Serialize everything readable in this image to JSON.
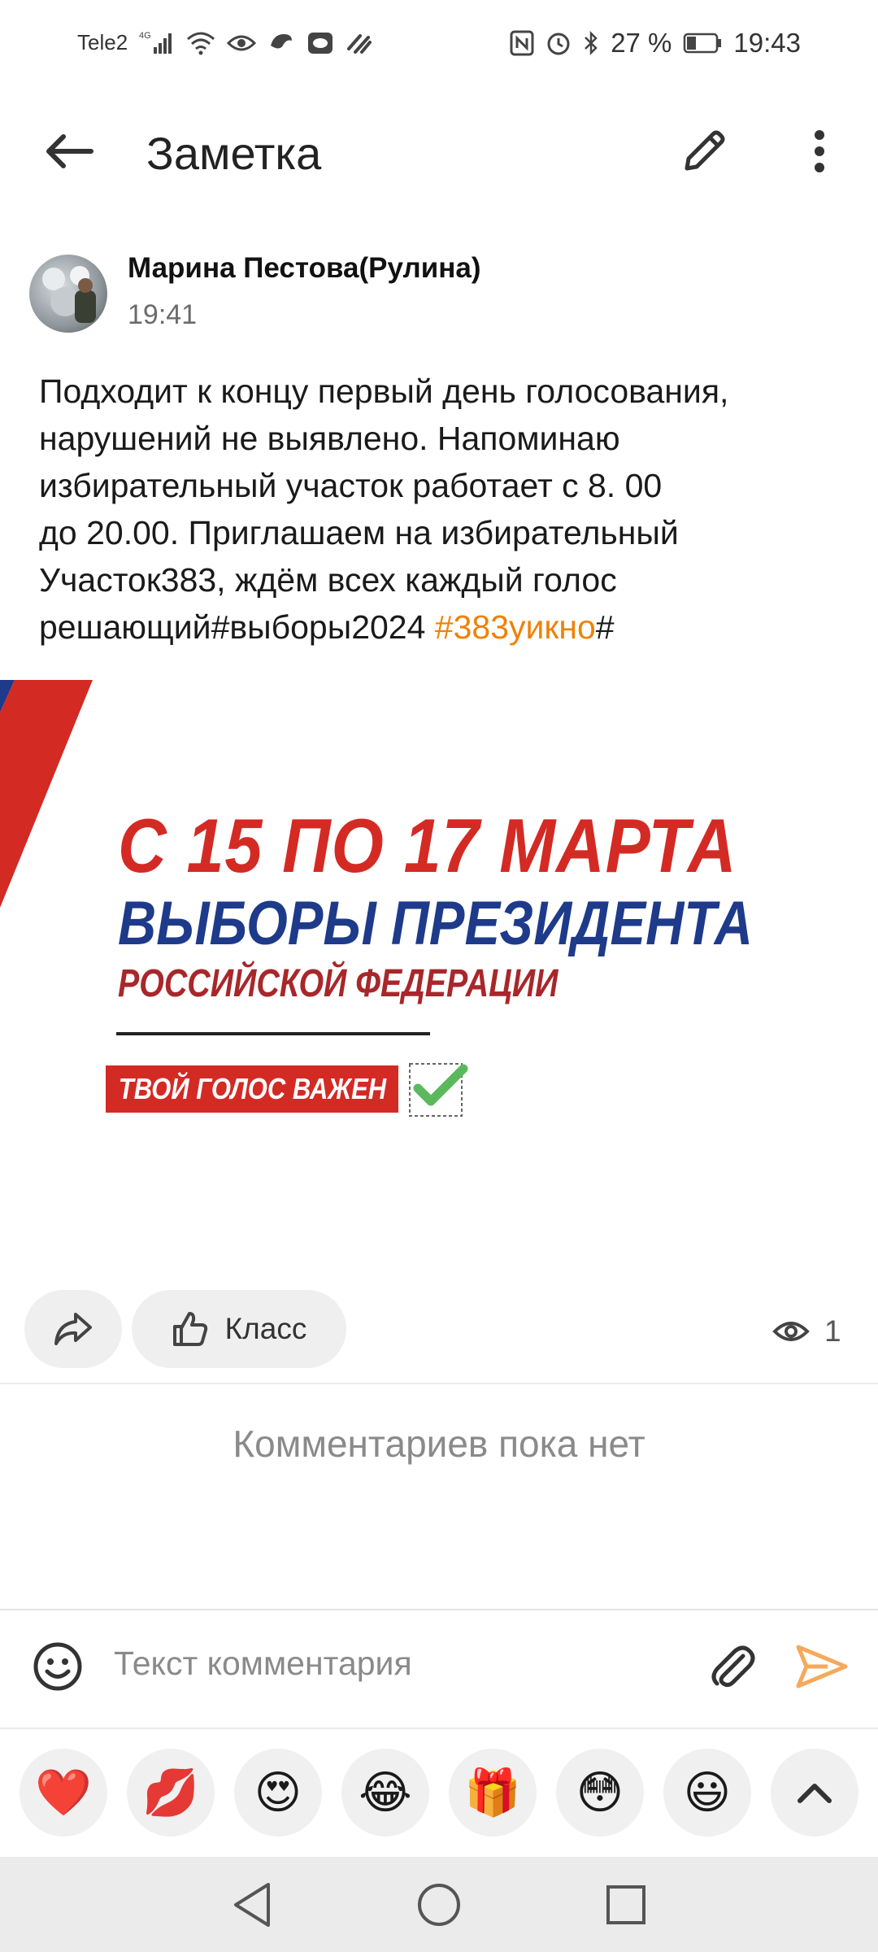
{
  "status_bar": {
    "carrier": "Tele2",
    "network": "4G",
    "battery": "27 %",
    "time": "19:43"
  },
  "appbar": {
    "title": "Заметка",
    "icons": [
      "arrow-back-icon",
      "pencil-icon",
      "more-vertical-icon"
    ]
  },
  "post": {
    "author": "Марина Пестова(Рулина)",
    "time": "19:41",
    "text_lines": [
      "Подходит к концу первый день голосования,",
      "нарушений не выявлено. Напоминаю",
      "избирательный участок работает с 8. 00",
      "до 20.00. Приглашаем на избирательный",
      "Участок383, ждём всех каждый голос"
    ],
    "last_line_text": "решающий#выборы2024 ",
    "hashtag": "#383уикно",
    "hashtag_after": "#"
  },
  "banner": {
    "line1": "С 15 ПО 17 МАРТА",
    "line2": "ВЫБОРЫ ПРЕЗИДЕНТА",
    "line3": "РОССИЙСКОЙ ФЕДЕРАЦИИ",
    "badge": "ТВОЙ ГОЛОС ВАЖЕН",
    "colors": {
      "red": "#d42a24",
      "blue": "#1e3a8a",
      "check": "#5cb85c"
    }
  },
  "actions": {
    "like_label": "Класс",
    "views_count": "1"
  },
  "comments": {
    "empty_text": "Комментариев пока нет",
    "input_placeholder": "Текст комментария"
  },
  "reactions": [
    {
      "emoji": "❤️",
      "name": "heart"
    },
    {
      "emoji": "💋",
      "name": "kiss"
    },
    {
      "emoji": "😍",
      "name": "heart-eyes"
    },
    {
      "emoji": "😂",
      "name": "tears-of-joy"
    },
    {
      "emoji": "🎁",
      "name": "gift"
    },
    {
      "emoji": "😳",
      "name": "flushed"
    },
    {
      "emoji": "😃",
      "name": "smile"
    }
  ],
  "accent_color": "#ee8208"
}
